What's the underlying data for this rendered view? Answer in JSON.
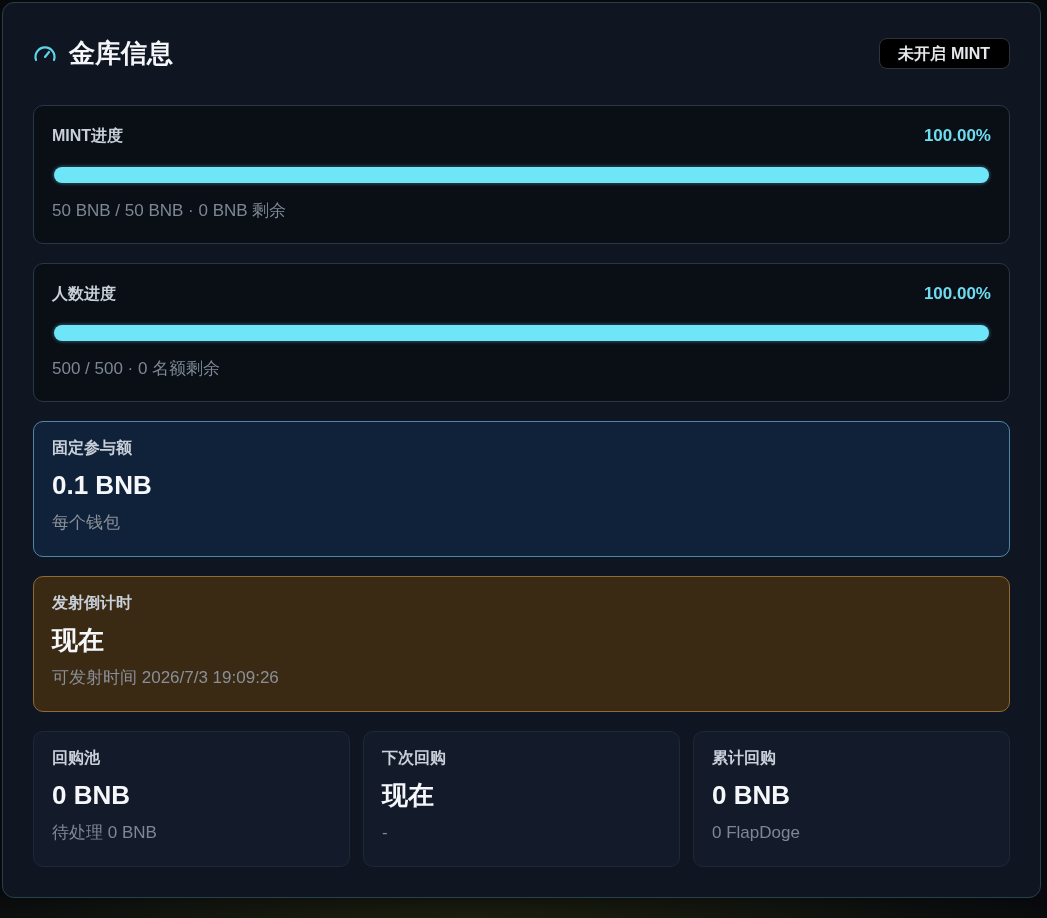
{
  "header": {
    "title": "金库信息",
    "badge": "未开启 MINT"
  },
  "progress": [
    {
      "label": "MINT进度",
      "percent": "100.00%",
      "level": 1,
      "detail": "50 BNB / 50 BNB · 0 BNB 剩余"
    },
    {
      "label": "人数进度",
      "percent": "100.00%",
      "level": 1,
      "detail": "500 / 500 · 0 名额剩余"
    }
  ],
  "highlights": [
    {
      "kind": "info",
      "label": "固定参与额",
      "value": "0.1 BNB",
      "note": "每个钱包"
    },
    {
      "kind": "warning",
      "label": "发射倒计时",
      "value": "现在",
      "note": "可发射时间 2026/7/3 19:09:26"
    }
  ],
  "stats": [
    {
      "label": "回购池",
      "value": "0 BNB",
      "note": "待处理 0 BNB"
    },
    {
      "label": "下次回购",
      "value": "现在",
      "note": "-"
    },
    {
      "label": "累计回购",
      "value": "0 BNB",
      "note": "0 FlapDoge"
    }
  ]
}
